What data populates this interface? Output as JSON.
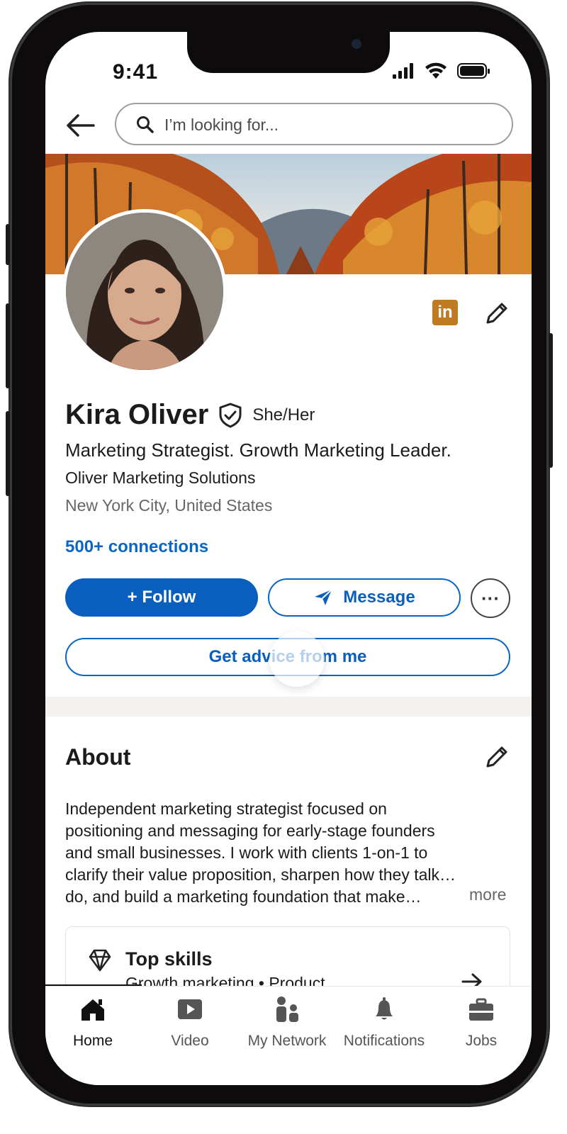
{
  "status_bar": {
    "time": "9:41"
  },
  "search": {
    "placeholder": "I’m looking for..."
  },
  "profile": {
    "name": "Kira Oliver",
    "pronouns": "She/Her",
    "headline": "Marketing Strategist. Growth Marketing Leader.",
    "company": "Oliver Marketing Solutions",
    "location": "New York City, United States",
    "connections": "500+ connections"
  },
  "actions": {
    "follow": "+ Follow",
    "message": "Message",
    "more": "···",
    "advice": "Get advice from me"
  },
  "about": {
    "title": "About",
    "text": "Independent marketing strategist focused on\npositioning and messaging for early-stage founders\nand small businesses. I work with clients 1-on-1 to\nclarify their value proposition, sharpen how they talk…\ndo, and build a marketing foundation that make…",
    "more": "more"
  },
  "skills": {
    "title": "Top skills",
    "subtitle": "Growth marketing • Product"
  },
  "nav": [
    {
      "label": "Home",
      "icon": "home-icon",
      "active": true
    },
    {
      "label": "Video",
      "icon": "video-icon"
    },
    {
      "label": "My Network",
      "icon": "network-icon"
    },
    {
      "label": "Notifications",
      "icon": "bell-icon"
    },
    {
      "label": "Jobs",
      "icon": "briefcase-icon"
    }
  ],
  "colors": {
    "brand_blue": "#0a66c2",
    "follow_bg": "#0a5fbe",
    "linkedin_badge": "#c07a22"
  }
}
